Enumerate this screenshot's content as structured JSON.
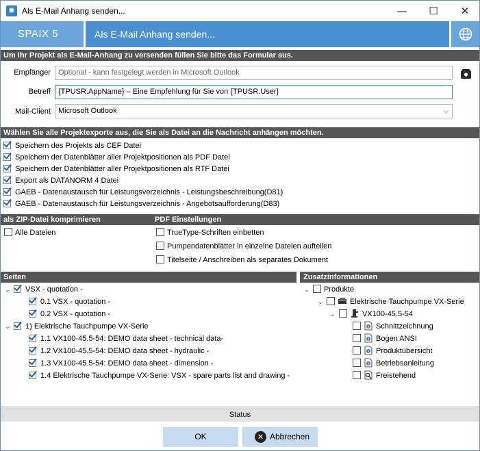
{
  "window": {
    "title": "Als E-Mail Anhang senden..."
  },
  "header": {
    "logo_text": "SPAIX 5",
    "title": "Als E-Mail Anhang senden..."
  },
  "form": {
    "intro": "Um Ihr Projekt als E-Mail-Anhang zu versenden füllen Sie bitte das Formular aus.",
    "recipient_label": "Empfänger",
    "recipient_placeholder": "Optional - kann festgelegt werden in Microsoft Outlook",
    "subject_label": "Betreff",
    "subject_value": "{TPUSR.AppName} – Eine Empfehlung für Sie von {TPUSR.User}",
    "mailclient_label": "Mail-Client",
    "mailclient_value": "Microsoft Outlook"
  },
  "exports": {
    "heading": "Wählen Sie alle Projektexporte aus, die Sie als Datei an die Nachricht anhängen möchten.",
    "items": [
      {
        "label": "Speichern des Projekts als CEF Datei",
        "checked": true
      },
      {
        "label": "Speichern der Datenblätter aller Projektpositionen als PDF Datei",
        "checked": true
      },
      {
        "label": "Speichern der Datenblätter aller Projektpositionen als RTF Datei",
        "checked": true
      },
      {
        "label": "Export als DATANORM 4 Datei",
        "checked": true
      },
      {
        "label": "GAEB - Datenaustausch für Leistungsverzeichnis - Leistungsbeschreibung(D81)",
        "checked": true
      },
      {
        "label": "GAEB - Datenaustausch für Leistungsverzeichnis - Angebotsaufforderung(D83)",
        "checked": true
      }
    ]
  },
  "zip": {
    "heading": "als ZIP-Datei komprimieren",
    "all_files": "Alle Dateien"
  },
  "pdf": {
    "heading": "PDF Einstellungen",
    "items": [
      "TrueType-Schriften einbetten",
      "Pumpendatenblätter in einzelne Dateien aufteilen",
      "Titelseite / Anschreiben als separates Dokument"
    ]
  },
  "pages": {
    "heading": "Seiten",
    "tree": [
      {
        "text": "VSX - quotation -",
        "level": 0
      },
      {
        "text": "0.1  VSX - quotation -",
        "level": 1
      },
      {
        "text": "0.2  VSX - quotation -",
        "level": 1
      },
      {
        "text": "1)  Elektrische Tauchpumpe VX-Serie",
        "level": 0
      },
      {
        "text": "1.1  VX100-45.5-54: DEMO data sheet - technical data-",
        "level": 1
      },
      {
        "text": "1.2  VX100-45.5-54: DEMO data sheet - hydraulic -",
        "level": 1
      },
      {
        "text": "1.3  VX100-45.5-54: DEMO data sheet - dimension -",
        "level": 1
      },
      {
        "text": "1.4  Elektrische Tauchpumpe VX-Serie: VSX - spare parts list and drawing -",
        "level": 1
      }
    ]
  },
  "extra": {
    "heading": "Zusatzinformationen",
    "tree": [
      {
        "text": "Produkte",
        "level": 0
      },
      {
        "text": "Elektrische Tauchpumpe VX-Serie",
        "level": 1
      },
      {
        "text": "VX100-45.5-54",
        "level": 2
      },
      {
        "text": "Schnittzeichnung",
        "level": 3
      },
      {
        "text": "Bogen ANSI",
        "level": 3
      },
      {
        "text": "Produktübersicht",
        "level": 3
      },
      {
        "text": "Betriebsanleitung",
        "level": 3
      },
      {
        "text": "Freistehend",
        "level": 3
      }
    ]
  },
  "status": {
    "label": "Status"
  },
  "buttons": {
    "ok": "OK",
    "cancel": "Abbrechen"
  },
  "colors": {
    "header_blue": "#4a8fd0",
    "header_light": "#6aa6dc",
    "section_bar": "#555555",
    "button_bg": "#c7dbf0"
  }
}
